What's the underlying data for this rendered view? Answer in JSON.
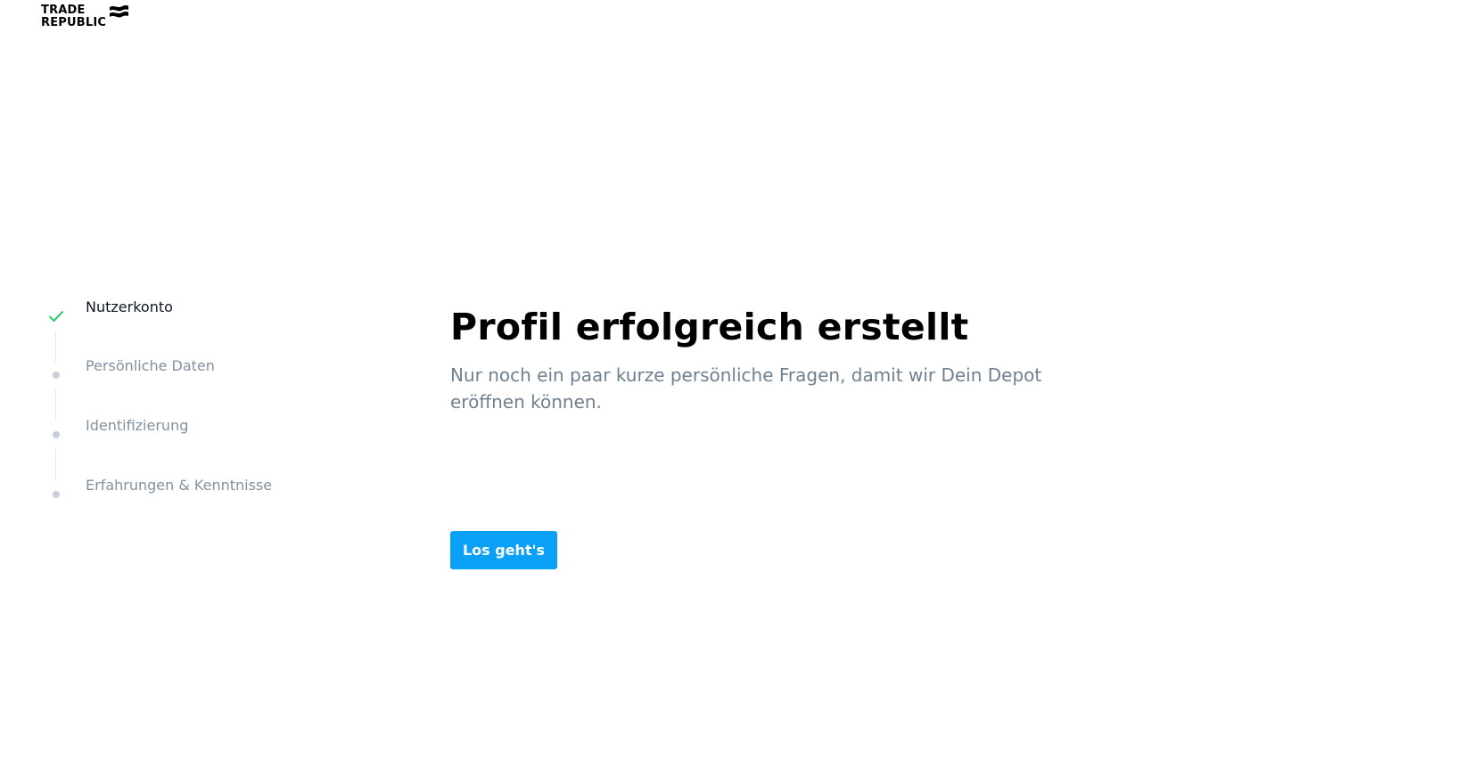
{
  "brand": {
    "line1": "TRADE",
    "line2": "REPUBLIC",
    "logo_icon": "flag-icon"
  },
  "stepper": {
    "steps": [
      {
        "label": "Nutzerkonto",
        "status": "completed",
        "icon": "checkmark-icon"
      },
      {
        "label": "Persönliche Daten",
        "status": "pending",
        "icon": "dot-icon"
      },
      {
        "label": "Identifizierung",
        "status": "pending",
        "icon": "dot-icon"
      },
      {
        "label": "Erfahrungen & Kenntnisse",
        "status": "pending",
        "icon": "dot-icon"
      }
    ]
  },
  "main": {
    "title": "Profil erfolgreich erstellt",
    "subtitle": "Nur noch ein paar kurze persönliche Fragen, damit wir Dein Depot eröffnen können.",
    "cta_label": "Los geht's"
  },
  "colors": {
    "accent": "#0aa0f5",
    "success": "#2ecc71",
    "muted_text": "#8290a0",
    "dot": "#c7cfd8"
  }
}
